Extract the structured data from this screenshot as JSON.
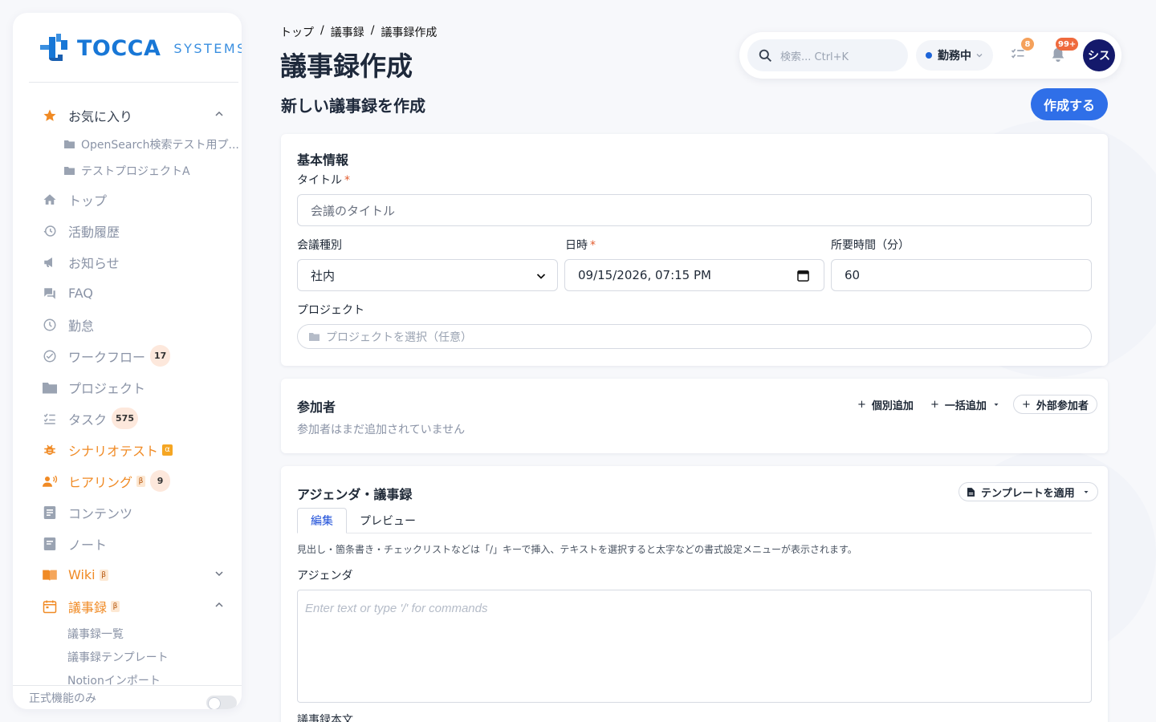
{
  "app": {
    "brand": "TOCCA",
    "brand_sub": "SYSTEMS"
  },
  "breadcrumb": [
    "トップ",
    "/",
    "議事録",
    "/",
    "議事録作成"
  ],
  "page_title": "議事録作成",
  "topbar": {
    "search_placeholder": "検索... Ctrl+K",
    "status_label": "勤務中",
    "tasks_badge": "8",
    "notifications_badge": "99+",
    "avatar_initials": "シス"
  },
  "sidebar": {
    "favorites_label": "お気に入り",
    "favorites": [
      "OpenSearch検索テスト用プ...",
      "テストプロジェクトA"
    ],
    "items": [
      {
        "label": "トップ",
        "icon": "home-icon"
      },
      {
        "label": "活動履歴",
        "icon": "history-icon"
      },
      {
        "label": "お知らせ",
        "icon": "megaphone-icon"
      },
      {
        "label": "FAQ",
        "icon": "chat-icon"
      },
      {
        "label": "勤怠",
        "icon": "clock-icon"
      },
      {
        "label": "ワークフロー",
        "icon": "check-circle-icon",
        "count": "17"
      },
      {
        "label": "プロジェクト",
        "icon": "folder-icon"
      },
      {
        "label": "タスク",
        "icon": "task-list-icon",
        "count": "575"
      },
      {
        "label": "シナリオテスト",
        "icon": "bug-icon",
        "tag": "α"
      },
      {
        "label": "ヒアリング",
        "icon": "speaker-icon",
        "tag": "β",
        "count": "9"
      },
      {
        "label": "コンテンツ",
        "icon": "document-icon"
      },
      {
        "label": "ノート",
        "icon": "note-icon"
      },
      {
        "label": "Wiki",
        "icon": "book-icon",
        "tag": "β"
      },
      {
        "label": "議事録",
        "icon": "calendar-icon",
        "tag": "β"
      }
    ],
    "minutes_sub": [
      "議事録一覧",
      "議事録テンプレート",
      "Notionインポート"
    ],
    "footer_label": "正式機能のみ"
  },
  "main": {
    "section_title": "新しい議事録を作成",
    "create_button": "作成する",
    "basic": {
      "title": "基本情報",
      "title_label": "タイトル",
      "title_placeholder": "会議のタイトル",
      "type_label": "会議種別",
      "type_value": "社内",
      "datetime_label": "日時",
      "datetime_value": "09/15/2026, 07:15 PM",
      "duration_label": "所要時間（分）",
      "duration_value": "60",
      "project_label": "プロジェクト",
      "project_placeholder": "プロジェクトを選択（任意）",
      "required_mark": "*"
    },
    "participants": {
      "title": "参加者",
      "empty": "参加者はまだ追加されていません",
      "add_individual": "個別追加",
      "add_bulk": "一括追加",
      "add_external": "外部参加者"
    },
    "agenda": {
      "title": "アジェンダ・議事録",
      "template_button": "テンプレートを適用",
      "tabs": [
        "編集",
        "プレビュー"
      ],
      "hint": "見出し・箇条書き・チェックリストなどは「/」キーで挿入、テキストを選択すると太字などの書式設定メニューが表示されます。",
      "agenda_label": "アジェンダ",
      "editor_placeholder": "Enter text or type '/' for commands",
      "body_label": "議事録本文"
    }
  },
  "colors": {
    "accent": "#2f6fe8",
    "brand": "#1877d6",
    "orange": "#f08a24",
    "avatar": "#14196b"
  }
}
